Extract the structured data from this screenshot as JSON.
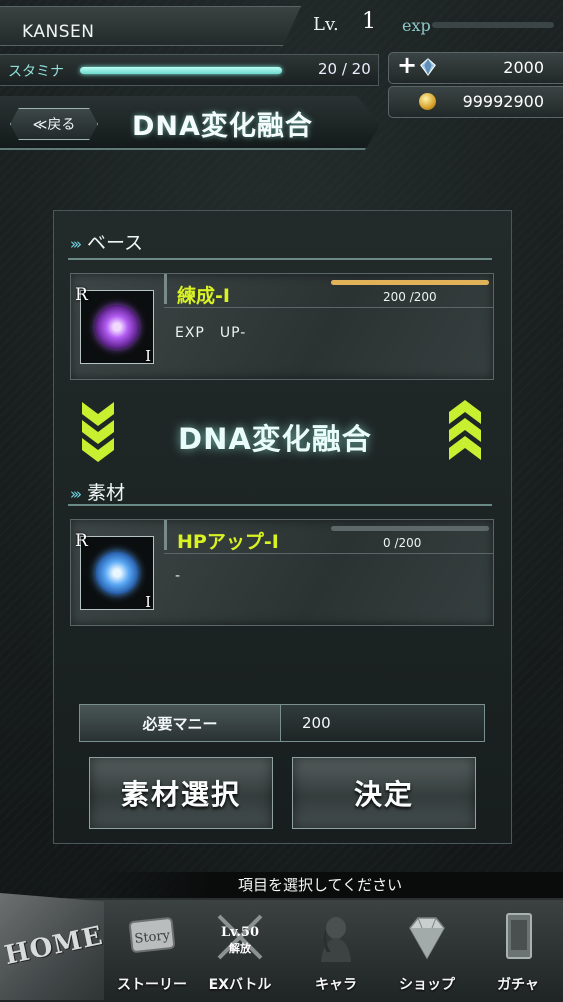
{
  "header": {
    "username": "KANSEN",
    "level_label": "Lv.",
    "level": "1",
    "exp_label": "exp",
    "exp_fraction": 0.0,
    "stamina_label": "スタミナ",
    "stamina_value": "20 / 20",
    "stamina_fraction": 1.0,
    "gem_plus": "+",
    "gems": "2000",
    "coins": "99992900"
  },
  "titlebar": {
    "back_label": "≪戻る",
    "title": "DNA変化融合"
  },
  "base_section": {
    "header": "ベース",
    "card": {
      "rarity": "R",
      "grade": "I",
      "name": "練成-I",
      "progress": "200 /200",
      "progress_fraction": 1.0,
      "description": "EXP　UP-"
    }
  },
  "middle_title": "DNA変化融合",
  "material_section": {
    "header": "素材",
    "card": {
      "rarity": "R",
      "grade": "I",
      "name": "HPアップ-I",
      "progress": "0 /200",
      "progress_fraction": 0.0,
      "description": "-"
    }
  },
  "money": {
    "label": "必要マニー",
    "value": "200"
  },
  "buttons": {
    "select_material": "素材選択",
    "confirm": "決定"
  },
  "hint": "項目を選択してください",
  "nav": {
    "home": "HOME",
    "items": [
      {
        "label": "ストーリー",
        "icon": "story-icon",
        "icon_text": "Story"
      },
      {
        "label": "EXバトル",
        "icon": "crossed-swords-icon",
        "icon_text": "Lv.50",
        "icon_subtext": "解放"
      },
      {
        "label": "キャラ",
        "icon": "character-icon"
      },
      {
        "label": "ショップ",
        "icon": "diamond-icon"
      },
      {
        "label": "ガチャ",
        "icon": "gacha-card-icon"
      }
    ]
  },
  "colors": {
    "accent_cyan": "#8ee8e0",
    "highlight_yellow": "#d9f224",
    "progress_gold": "#e2b25a"
  }
}
